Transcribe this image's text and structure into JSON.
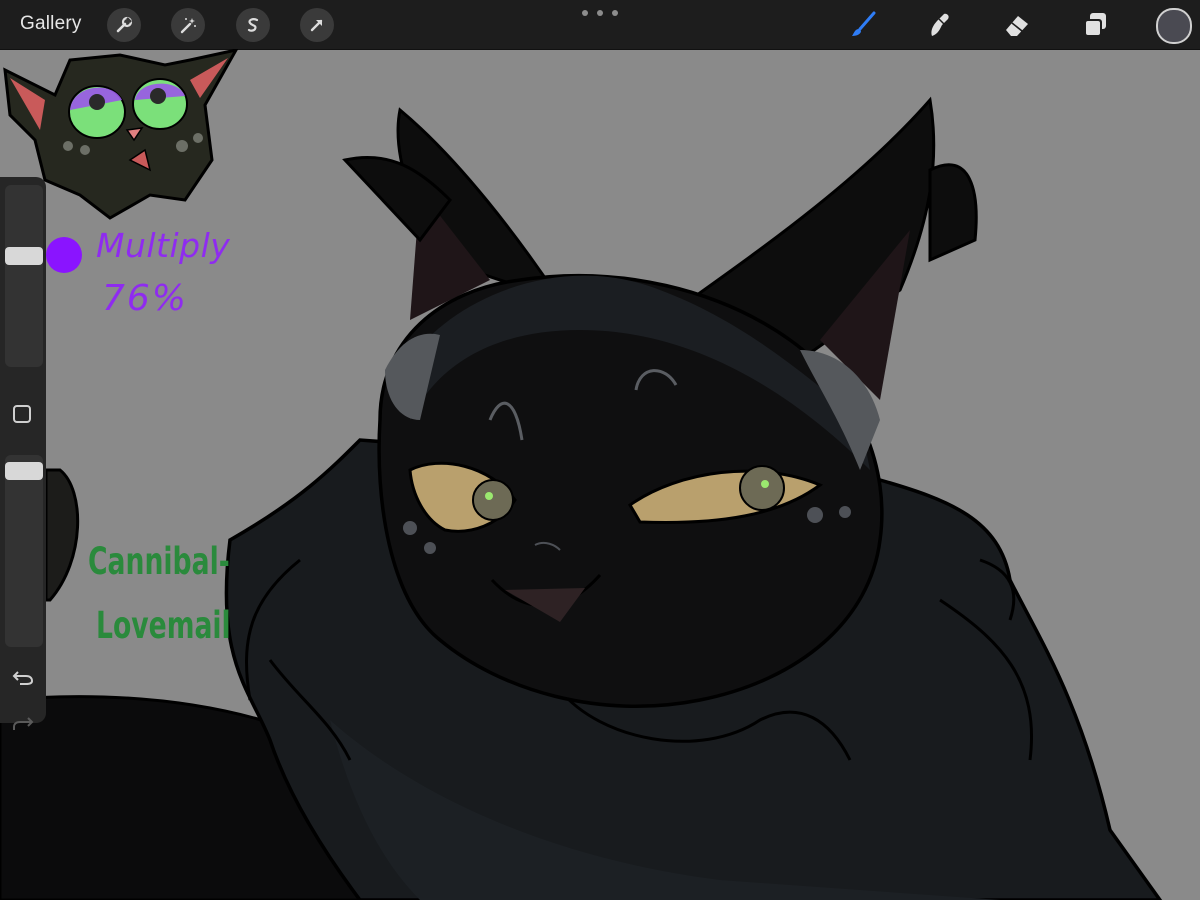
{
  "toolbar": {
    "gallery_label": "Gallery",
    "actions": [
      "wrench-icon",
      "magic-wand-icon",
      "selection-icon",
      "transform-arrow-icon"
    ],
    "tools": [
      "brush-icon",
      "smudge-icon",
      "eraser-icon",
      "layers-icon"
    ],
    "active_tool": "brush-icon",
    "active_tool_color": "#2f7df6",
    "current_color": "#4a4a52"
  },
  "sidebar": {
    "brush_size_level": 0.62,
    "opacity_level": 0.96,
    "controls": [
      "modify-square-icon",
      "undo-icon",
      "redo-icon"
    ]
  },
  "canvas": {
    "background_color": "#8a8a8a",
    "notes": {
      "blend_mode": "Multiply",
      "opacity_text": "76%",
      "note_color": "#8f2bf0"
    },
    "watermark": {
      "line1": "Cannibal-",
      "line2": "Lovemail",
      "color": "#2a8a3c"
    }
  }
}
